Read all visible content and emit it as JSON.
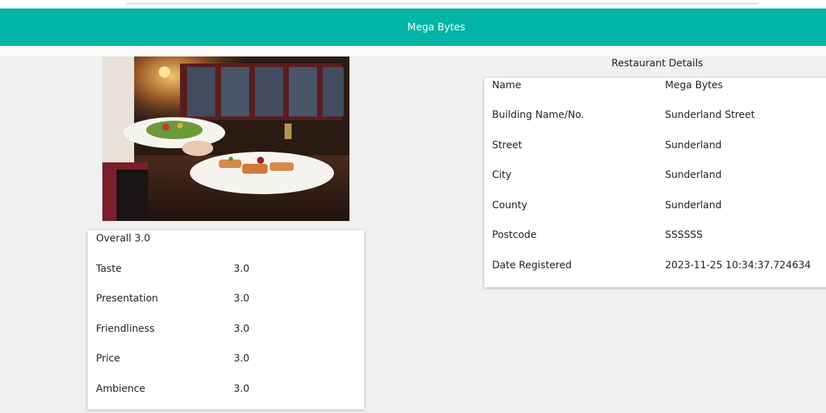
{
  "header": {
    "title": "Mega Bytes"
  },
  "photo": {
    "alt": "waiter-serving-dishes"
  },
  "ratings": {
    "overall_label": "Overall 3.0",
    "rows": [
      {
        "label": "Taste",
        "value": "3.0"
      },
      {
        "label": "Presentation",
        "value": "3.0"
      },
      {
        "label": "Friendliness",
        "value": "3.0"
      },
      {
        "label": "Price",
        "value": "3.0"
      },
      {
        "label": "Ambience",
        "value": "3.0"
      }
    ]
  },
  "details": {
    "title": "Restaurant Details",
    "rows": [
      {
        "label": "Name",
        "value": "Mega Bytes"
      },
      {
        "label": "Building Name/No.",
        "value": "Sunderland Street"
      },
      {
        "label": "Street",
        "value": "Sunderland"
      },
      {
        "label": "City",
        "value": "Sunderland"
      },
      {
        "label": "County",
        "value": "Sunderland"
      },
      {
        "label": "Postcode",
        "value": "SSSSSS"
      },
      {
        "label": "Date Registered",
        "value": "2023-11-25 10:34:37.724634"
      }
    ]
  },
  "colors": {
    "accent": "#00b5a6",
    "background": "#f0f0f0",
    "card": "#ffffff"
  }
}
